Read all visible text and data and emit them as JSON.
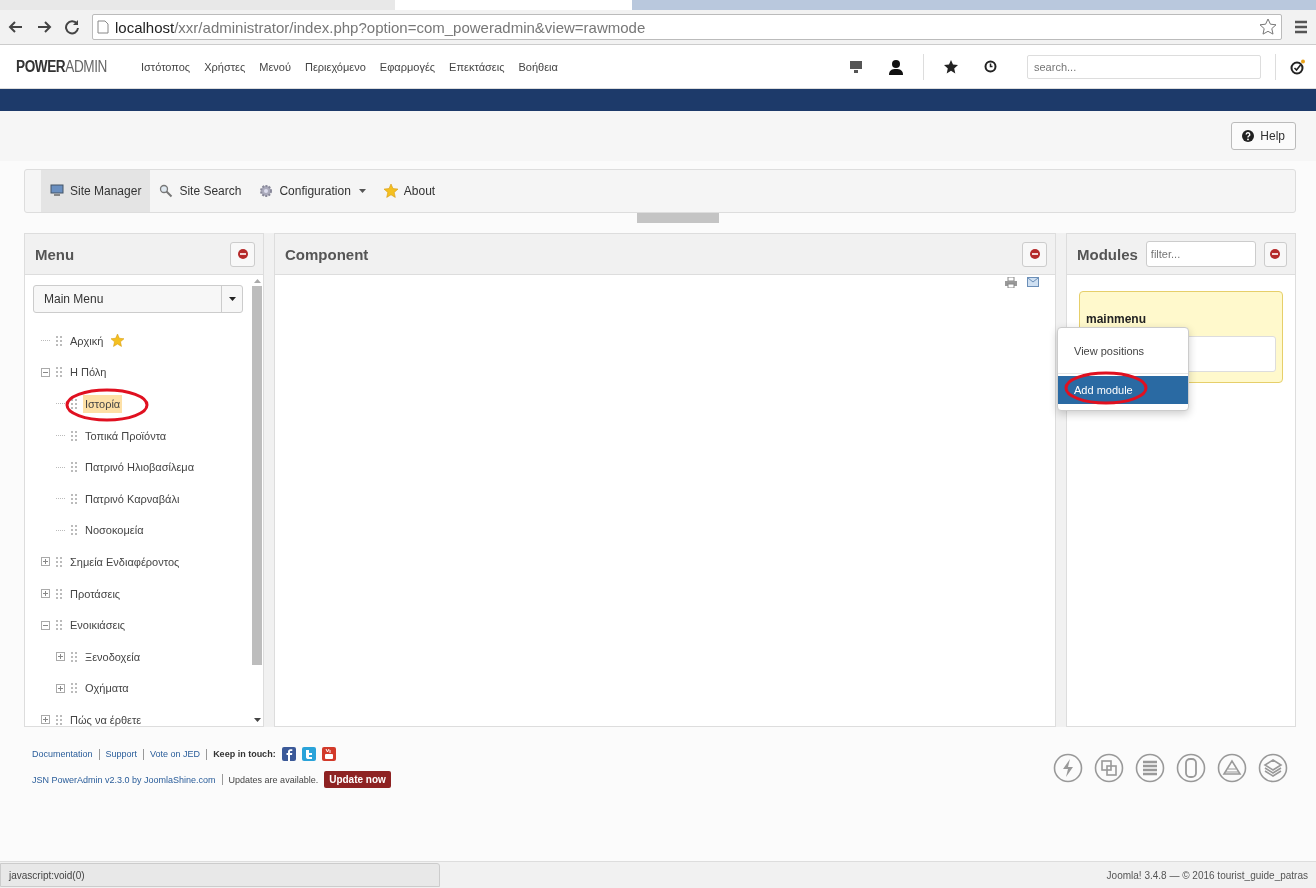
{
  "browser": {
    "url_host": "localhost",
    "url_path": "/xxr/administrator/index.php?option=com_poweradmin&view=rawmode"
  },
  "admin_bar": {
    "logo_bold": "POWER",
    "logo_light": "ADMIN",
    "menu": [
      "Ιστότοπος",
      "Χρήστες",
      "Μενού",
      "Περιεχόμενο",
      "Εφαρμογές",
      "Επεκτάσεις",
      "Βοήθεια"
    ],
    "search": {
      "placeholder": "search..."
    }
  },
  "toolbar": {
    "help_button": "Help"
  },
  "tabs": [
    {
      "label": "Site Manager",
      "selected": true,
      "dropdown": false
    },
    {
      "label": "Site Search",
      "selected": false,
      "dropdown": false
    },
    {
      "label": "Configuration",
      "selected": false,
      "dropdown": true
    },
    {
      "label": "About",
      "selected": false,
      "dropdown": false
    }
  ],
  "menu_panel": {
    "title": "Menu",
    "select": "Main Menu",
    "tree": [
      {
        "label": "Αρχική",
        "starred": true,
        "selected": false,
        "kind": "leaf"
      },
      {
        "label": "Η Πόλη",
        "starred": false,
        "selected": false,
        "kind": "folder",
        "expanded": true,
        "children": [
          {
            "label": "Ιστορία",
            "starred": false,
            "selected": true,
            "kind": "leaf",
            "circled": true
          },
          {
            "label": "Τοπικά Προϊόντα",
            "starred": false,
            "selected": false,
            "kind": "leaf"
          },
          {
            "label": "Πατρινό Ηλιοβασίλεμα",
            "starred": false,
            "selected": false,
            "kind": "leaf"
          },
          {
            "label": "Πατρινό Καρναβάλι",
            "starred": false,
            "selected": false,
            "kind": "leaf"
          },
          {
            "label": "Νοσοκομεία",
            "starred": false,
            "selected": false,
            "kind": "leaf"
          }
        ]
      },
      {
        "label": "Σημεία Ενδιαφέροντος",
        "starred": false,
        "selected": false,
        "kind": "folder",
        "expanded": false
      },
      {
        "label": "Προτάσεις",
        "starred": false,
        "selected": false,
        "kind": "folder",
        "expanded": false
      },
      {
        "label": "Ενοικιάσεις",
        "starred": false,
        "selected": false,
        "kind": "folder",
        "expanded": true,
        "children": [
          {
            "label": "Ξενοδοχεία",
            "starred": false,
            "selected": false,
            "kind": "folder",
            "expanded": false
          },
          {
            "label": "Οχήματα",
            "starred": false,
            "selected": false,
            "kind": "folder",
            "expanded": false
          }
        ]
      },
      {
        "label": "Πώς να έρθετε",
        "starred": false,
        "selected": false,
        "kind": "folder",
        "expanded": false
      }
    ]
  },
  "component_panel": {
    "title": "Component"
  },
  "modules_panel": {
    "title": "Modules",
    "filter": {
      "placeholder": "filter..."
    },
    "module": {
      "title": "mainmenu"
    }
  },
  "context_menu": {
    "items": [
      {
        "label": "View positions",
        "selected": false,
        "circled": false
      },
      {
        "label": "Add module",
        "selected": true,
        "circled": true
      }
    ]
  },
  "footer": {
    "links": [
      "Documentation",
      "Support",
      "Vote on JED"
    ],
    "keep_in_touch": "Keep in touch:",
    "version": "JSN PowerAdmin v2.3.0 by JoomlaShine.com",
    "updates": "Updates are available.",
    "update_button": "Update now"
  },
  "status_bar": {
    "link": "javascript:void(0)",
    "copyright": "Joomla! 3.4.8 — © 2016 tourist_guide_patras"
  }
}
